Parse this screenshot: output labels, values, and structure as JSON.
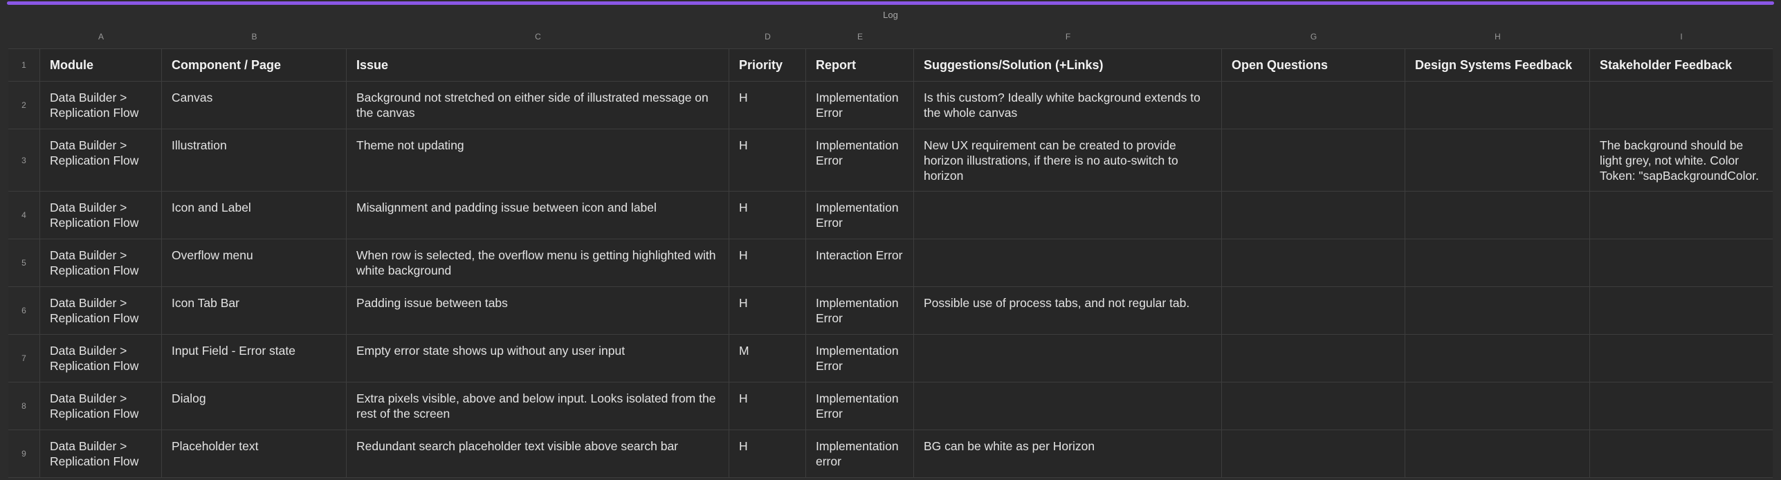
{
  "sheet": {
    "title": "Log",
    "accent_color": "#8a57e6",
    "columns": [
      "A",
      "B",
      "C",
      "D",
      "E",
      "F",
      "G",
      "H",
      "I"
    ],
    "headers": [
      "Module",
      "Component / Page",
      "Issue",
      "Priority",
      "Report",
      "Suggestions/Solution (+Links)",
      "Open Questions",
      "Design Systems Feedback",
      "Stakeholder Feedback"
    ],
    "header_row_number": "1",
    "rows": [
      {
        "num": "2",
        "cells": [
          "Data Builder > Replication Flow",
          "Canvas",
          "Background not stretched on either side of illustrated message on the canvas",
          "H",
          "Implementation Error",
          "Is this custom? Ideally white background extends to the whole canvas",
          "",
          "",
          ""
        ]
      },
      {
        "num": "3",
        "cells": [
          "Data Builder > Replication Flow",
          "Illustration",
          "Theme not updating",
          "H",
          "Implementation Error",
          "New UX requirement can be created to provide horizon illustrations, if there is no auto-switch to horizon",
          "",
          "",
          "The background should be light grey, not white. Color Token: \"sapBackgroundColor."
        ]
      },
      {
        "num": "4",
        "cells": [
          "Data Builder > Replication Flow",
          "Icon and Label",
          "Misalignment and padding issue between icon and label",
          "H",
          "Implementation Error",
          "",
          "",
          "",
          ""
        ]
      },
      {
        "num": "5",
        "cells": [
          "Data Builder > Replication Flow",
          "Overflow menu",
          "When row is selected, the overflow menu is getting highlighted with white background",
          "H",
          "Interaction Error",
          "",
          "",
          "",
          ""
        ]
      },
      {
        "num": "6",
        "cells": [
          "Data Builder > Replication Flow",
          "Icon Tab Bar",
          "Padding issue between tabs",
          "H",
          "Implementation Error",
          "Possible use of process tabs, and not regular tab.",
          "",
          "",
          ""
        ]
      },
      {
        "num": "7",
        "cells": [
          "Data Builder > Replication Flow",
          "Input Field - Error state",
          "Empty error state shows up without any user input",
          "M",
          "Implementation Error",
          "",
          "",
          "",
          ""
        ]
      },
      {
        "num": "8",
        "cells": [
          "Data Builder > Replication Flow",
          "Dialog",
          "Extra pixels visible, above and below input. Looks isolated from the rest of the screen",
          "H",
          "Implementation Error",
          "",
          "",
          "",
          ""
        ]
      },
      {
        "num": "9",
        "cells": [
          "Data Builder > Replication Flow",
          "Placeholder text",
          "Redundant search placeholder text visible above search bar",
          "H",
          "Implementation error",
          "BG can be white as per Horizon",
          "",
          "",
          ""
        ]
      }
    ]
  }
}
